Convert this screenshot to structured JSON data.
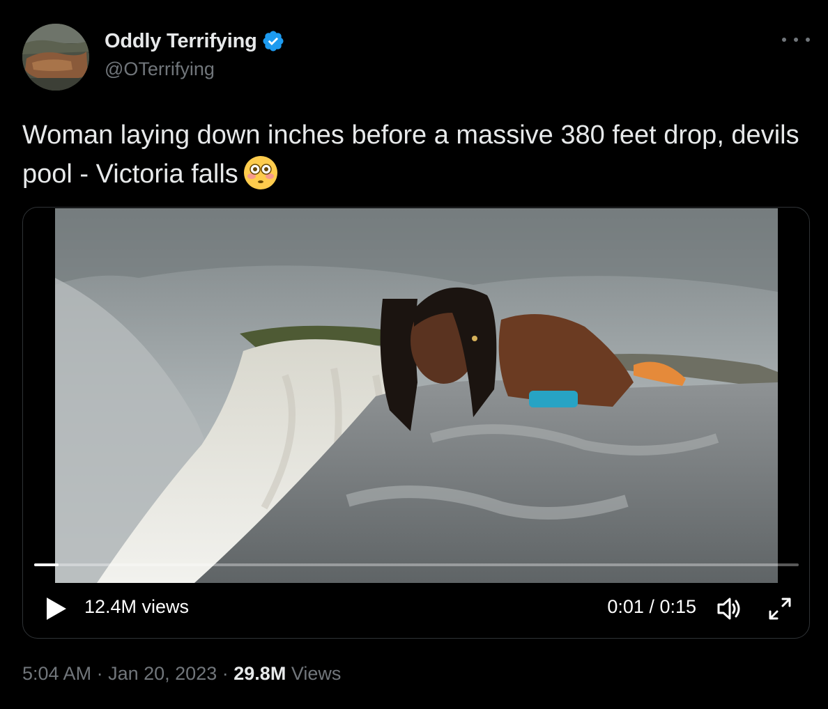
{
  "author": {
    "display_name": "Oddly Terrifying",
    "handle": "@OTerrifying",
    "verified_icon": "verified-badge-icon",
    "accent_color": "#1d9bf0"
  },
  "tweet": {
    "text": "Woman laying down inches before a massive 380 feet drop, devils pool - Victoria falls",
    "emoji": "flushed-face-icon"
  },
  "video": {
    "view_count": "12.4M views",
    "elapsed": "0:01",
    "separator": "/",
    "duration": "0:15",
    "progress_fraction": 0.032
  },
  "meta": {
    "time": "5:04 AM",
    "dot1": "·",
    "date": "Jan 20, 2023",
    "dot2": "·",
    "views_count": "29.8M",
    "views_label": "Views"
  }
}
